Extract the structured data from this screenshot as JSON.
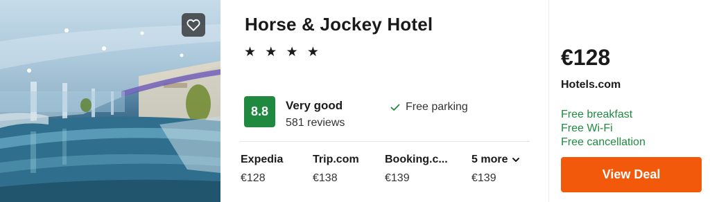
{
  "hotel": {
    "name": "Horse & Jockey Hotel",
    "stars": "★ ★ ★ ★",
    "favorite_icon": "heart-outline-icon"
  },
  "rating": {
    "score": "8.8",
    "label": "Very good",
    "reviews": "581 reviews",
    "badge_color": "#1f8a3f"
  },
  "amenities": [
    {
      "icon": "checkmark-icon",
      "label": "Free parking"
    }
  ],
  "providers": [
    {
      "name": "Expedia",
      "price": "€128"
    },
    {
      "name": "Trip.com",
      "price": "€138"
    },
    {
      "name": "Booking.c...",
      "price": "€139"
    }
  ],
  "more_providers": {
    "label": "5 more",
    "price": "€139",
    "icon": "chevron-down-icon"
  },
  "deal": {
    "price": "€128",
    "provider": "Hotels.com",
    "perks": [
      "Free breakfast",
      "Free Wi-Fi",
      "Free cancellation"
    ],
    "button_label": "View Deal",
    "button_color": "#f2590b",
    "perk_color": "#1f8a3f"
  }
}
